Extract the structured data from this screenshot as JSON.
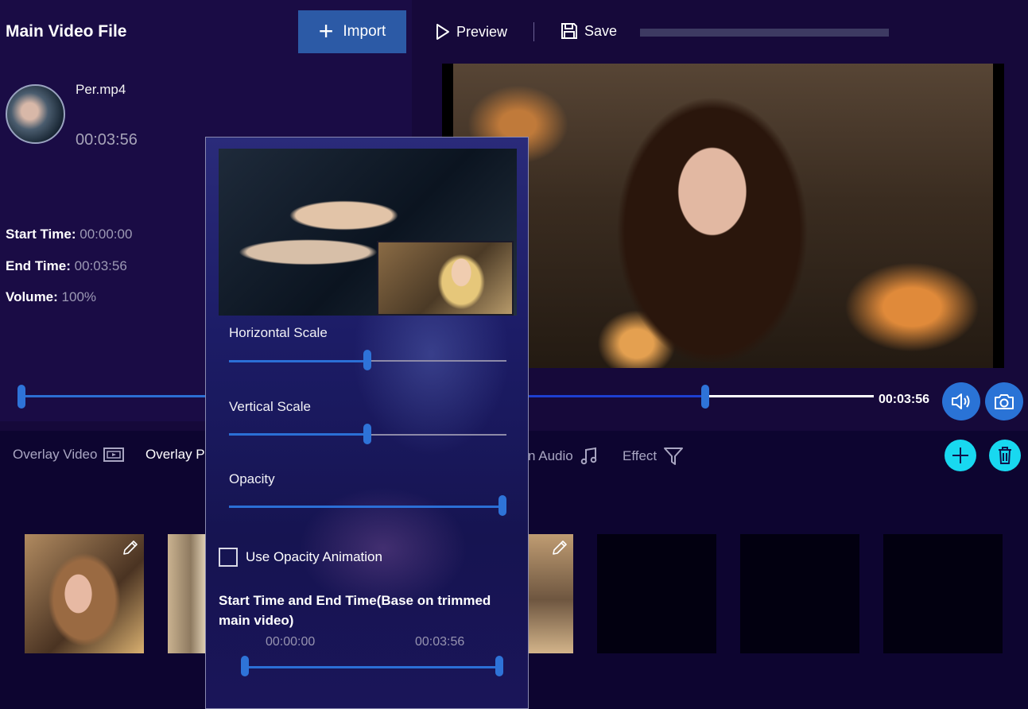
{
  "header": {
    "title": "Main Video File",
    "import_label": "Import",
    "preview_label": "Preview",
    "save_label": "Save"
  },
  "main_file": {
    "name": "Per.mp4",
    "duration": "00:03:56",
    "start_label": "Start Time:",
    "start_value": "00:00:00",
    "end_label": "End Time:",
    "end_value": "00:03:56",
    "volume_label": "Volume:",
    "volume_value": "100%"
  },
  "player": {
    "time": "00:03:56",
    "position_fraction": 0.72
  },
  "tabs": {
    "overlay_video": "Overlay Video",
    "overlay_picture": "Overlay Pi",
    "audio": "n Audio",
    "effect": "Effect"
  },
  "popup": {
    "horizontal_scale_label": "Horizontal Scale",
    "horizontal_scale_value": 0.5,
    "vertical_scale_label": "Vertical Scale",
    "vertical_scale_value": 0.5,
    "opacity_label": "Opacity",
    "opacity_value": 1.0,
    "opacity_animation_label": "Use Opacity Animation",
    "opacity_animation_checked": false,
    "range_title": "Start Time and End Time(Base on trimmed main video)",
    "range_start": "00:00:00",
    "range_end": "00:03:56"
  },
  "colors": {
    "accent": "#2e73d8",
    "import_bg": "#2c5aa6",
    "action_cyan": "#18d8f0",
    "background": "#16093a"
  },
  "icons": [
    "plus-icon",
    "play-outline-icon",
    "floppy-disk-icon",
    "speaker-icon",
    "camera-icon",
    "film-icon",
    "music-note-icon",
    "filter-funnel-icon",
    "add-icon",
    "trash-icon",
    "pencil-icon"
  ]
}
